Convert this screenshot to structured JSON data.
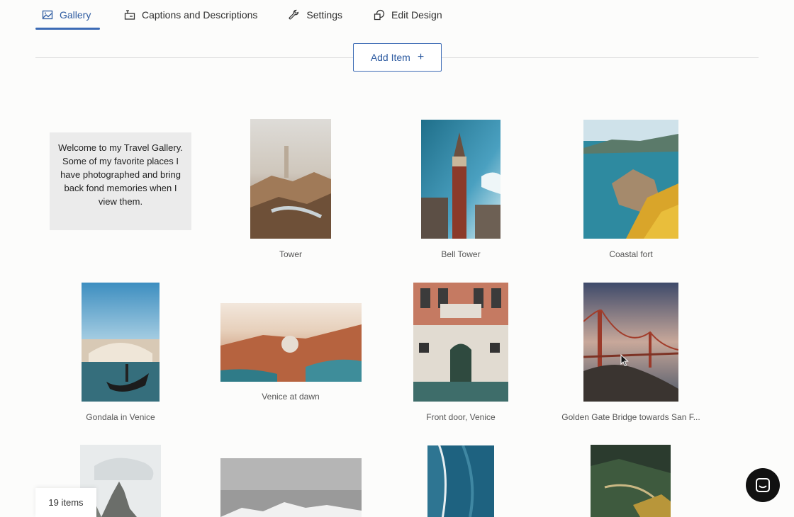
{
  "tabs": [
    {
      "label": "Gallery",
      "icon": "image-icon",
      "active": true
    },
    {
      "label": "Captions and Descriptions",
      "icon": "captions-icon"
    },
    {
      "label": "Settings",
      "icon": "wrench-icon"
    },
    {
      "label": "Edit Design",
      "icon": "design-icon"
    }
  ],
  "add_item": {
    "label": "Add Item",
    "icon": "plus-icon",
    "plus": "+"
  },
  "welcome_text": "Welcome to my Travel Gallery. Some of my favorite places I have photographed and bring back fond memories when I view them.",
  "gallery": {
    "items": [
      {
        "caption": "Tower"
      },
      {
        "caption": "Bell Tower"
      },
      {
        "caption": "Coastal fort"
      },
      {
        "caption": "Gondala in Venice"
      },
      {
        "caption": "Venice at dawn"
      },
      {
        "caption": "Front door, Venice"
      },
      {
        "caption": "Golden Gate Bridge towards San F..."
      }
    ]
  },
  "item_count": "19 items",
  "chat": {
    "icon": "chat-icon"
  }
}
